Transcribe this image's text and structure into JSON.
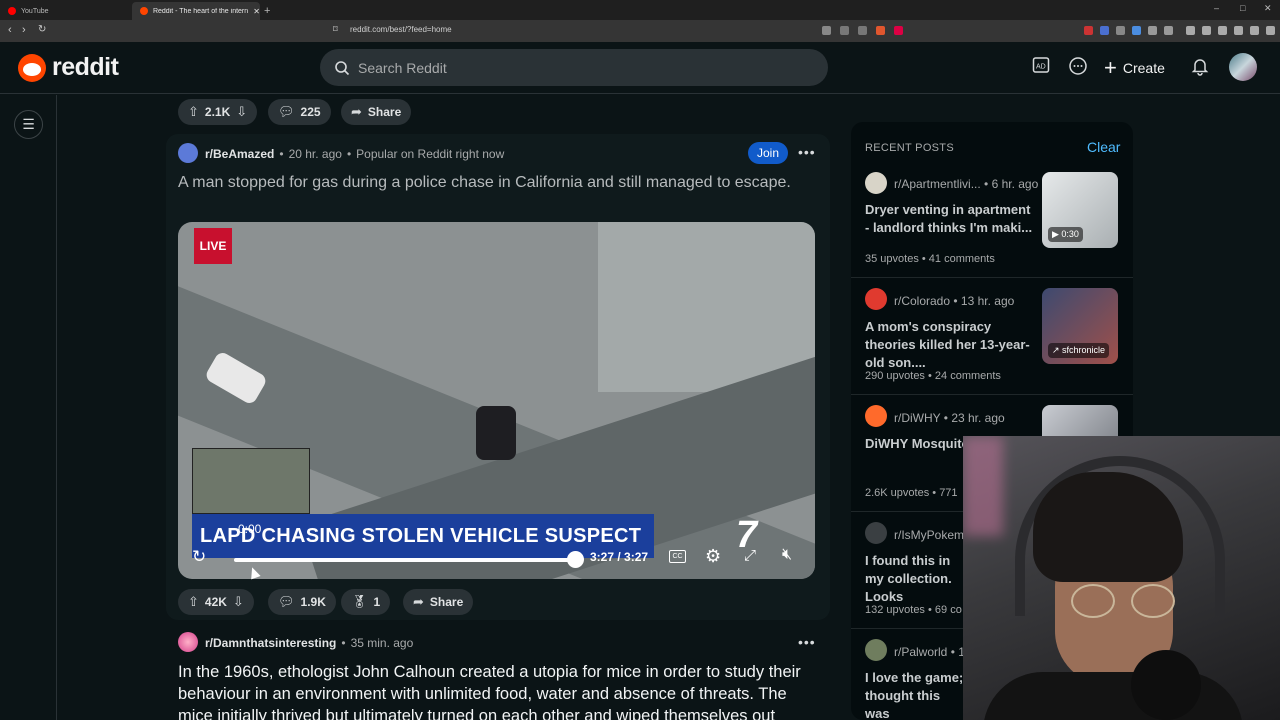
{
  "browser": {
    "tabs": [
      {
        "label": "YouTube",
        "color": "#ff0000"
      },
      {
        "label": "Reddit - The heart of the interne",
        "color": "#ff4500"
      }
    ],
    "new_tab": "+",
    "url": "reddit.com/best/?feed=home",
    "window_controls": {
      "minimize": "–",
      "maximize": "□",
      "close": "✕"
    }
  },
  "header": {
    "logo_text": "reddit",
    "search_placeholder": "Search Reddit",
    "create_label": "Create",
    "icons": [
      "advertise-icon",
      "chat-icon",
      "plus-icon",
      "bell-icon"
    ]
  },
  "top_actions": {
    "upvotes": "2.1K",
    "comments": "225",
    "share": "Share"
  },
  "post1": {
    "subreddit": "r/BeAmazed",
    "time": "20 hr. ago",
    "tag": "Popular on Reddit right now",
    "join": "Join",
    "title": "A man stopped for gas during a police chase in California and still managed to escape.",
    "video": {
      "live": "LIVE",
      "chyron": "LAPD CHASING STOLEN VEHICLE SUSPECT",
      "network": "7",
      "hover_time": "0:00",
      "time": "3:27 / 3:27",
      "cc": "CC",
      "progress": 1.0
    },
    "votes": "42K",
    "comments": "1.9K",
    "awards": "1",
    "share": "Share"
  },
  "post2": {
    "subreddit": "r/Damnthatsinteresting",
    "time": "35 min. ago",
    "title": "In the 1960s, ethologist John Calhoun created a utopia for mice in order to study their behaviour in an environment with unlimited food, water and absence of threats. The mice initially thrived but ultimately turned on each other and wiped themselves out"
  },
  "sidebar": {
    "heading": "RECENT POSTS",
    "clear": "Clear",
    "items": [
      {
        "sub": "r/Apartmentlivi...",
        "time": "6 hr. ago",
        "title": "Dryer venting in apartment - landlord thinks I'm maki...",
        "upvotes": "35 upvotes",
        "comments": "41 comments",
        "thumb_badge": "▶ 0:30",
        "icon_color": "#d8d4c8",
        "thumb_color": "#cfd3d4"
      },
      {
        "sub": "r/Colorado",
        "time": "13 hr. ago",
        "title": "A mom's conspiracy theories killed her 13-year-old son....",
        "upvotes": "290 upvotes",
        "comments": "24 comments",
        "thumb_badge": "↗ sfchronicle",
        "icon_color": "#e03a2f",
        "thumb_color": "#5b6a8a"
      },
      {
        "sub": "r/DiWHY",
        "time": "23 hr. ago",
        "title": "DiWHY Mosquito",
        "upvotes": "2.6K upvotes",
        "comments": "771",
        "thumb_badge": "",
        "icon_color": "#ff6a2b",
        "thumb_color": "#8a8e95"
      },
      {
        "sub": "r/IsMyPokemo",
        "time": "",
        "title": "I found this in my collection. Looks",
        "upvotes": "132 upvotes",
        "comments": "69 co",
        "thumb_badge": "",
        "icon_color": "#3a3f42",
        "thumb_color": "#333"
      },
      {
        "sub": "r/Palworld",
        "time": "1",
        "title": "I love the game; thought this was",
        "upvotes": "",
        "comments": "",
        "thumb_badge": "",
        "icon_color": "#6f7d5e",
        "thumb_color": "#333"
      }
    ]
  },
  "colors": {
    "brand": "#ff4500",
    "join": "#115bca",
    "link": "#4fbcff",
    "background": "#0b1416"
  }
}
